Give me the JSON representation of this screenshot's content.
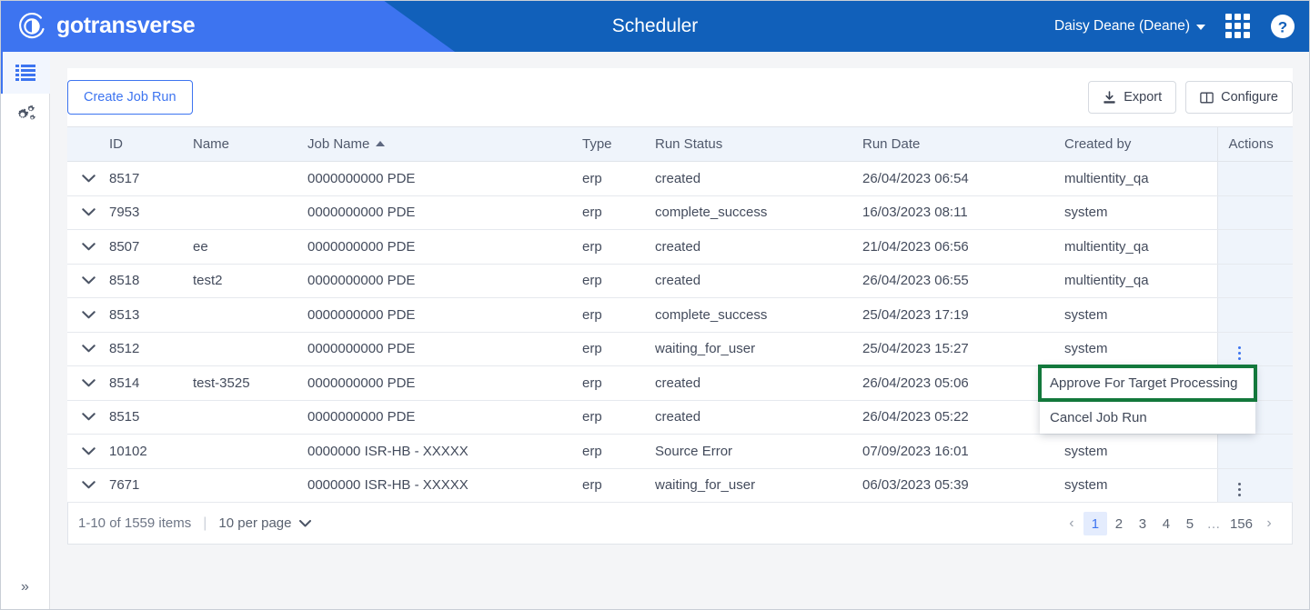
{
  "header": {
    "brand": "gotransverse",
    "brand_logo_icon": "gotransverse-circle-logo",
    "title": "Scheduler",
    "user": "Daisy Deane (Deane)",
    "apps_icon": "grid-apps-icon",
    "help_icon": "help-question-icon",
    "bg_color": "#1160ba",
    "wedge_color": "#3d74f0"
  },
  "sidebar": {
    "items": [
      {
        "icon": "list-lines-icon",
        "name": "sidebar-item-jobs",
        "active": true
      },
      {
        "icon": "gears-settings-icon",
        "name": "sidebar-item-settings",
        "active": false
      }
    ],
    "collapse_icon": "chevron-double-right-icon"
  },
  "toolbar": {
    "create_label": "Create Job Run",
    "export_label": "Export",
    "export_icon": "download-icon",
    "configure_label": "Configure",
    "configure_icon": "columns-layout-icon"
  },
  "table": {
    "columns": [
      {
        "key": "expand",
        "label": ""
      },
      {
        "key": "id",
        "label": "ID"
      },
      {
        "key": "name",
        "label": "Name"
      },
      {
        "key": "job_name",
        "label": "Job Name",
        "sorted": "asc"
      },
      {
        "key": "type",
        "label": "Type"
      },
      {
        "key": "run_status",
        "label": "Run Status"
      },
      {
        "key": "run_date",
        "label": "Run Date"
      },
      {
        "key": "created_by",
        "label": "Created by"
      },
      {
        "key": "actions",
        "label": "Actions"
      }
    ],
    "rows": [
      {
        "id": "8517",
        "name": "",
        "job_name": "0000000000 PDE",
        "type": "erp",
        "run_status": "created",
        "run_date": "26/04/2023 06:54",
        "created_by": "multientity_qa",
        "kebab": "none"
      },
      {
        "id": "7953",
        "name": "",
        "job_name": "0000000000 PDE",
        "type": "erp",
        "run_status": "complete_success",
        "run_date": "16/03/2023 08:11",
        "created_by": "system",
        "kebab": "none"
      },
      {
        "id": "8507",
        "name": "ee",
        "job_name": "0000000000 PDE",
        "type": "erp",
        "run_status": "created",
        "run_date": "21/04/2023 06:56",
        "created_by": "multientity_qa",
        "kebab": "none"
      },
      {
        "id": "8518",
        "name": "test2",
        "job_name": "0000000000 PDE",
        "type": "erp",
        "run_status": "created",
        "run_date": "26/04/2023 06:55",
        "created_by": "multientity_qa",
        "kebab": "none"
      },
      {
        "id": "8513",
        "name": "",
        "job_name": "0000000000 PDE",
        "type": "erp",
        "run_status": "complete_success",
        "run_date": "25/04/2023 17:19",
        "created_by": "system",
        "kebab": "none"
      },
      {
        "id": "8512",
        "name": "",
        "job_name": "0000000000 PDE",
        "type": "erp",
        "run_status": "waiting_for_user",
        "run_date": "25/04/2023 15:27",
        "created_by": "system",
        "kebab": "blue"
      },
      {
        "id": "8514",
        "name": "test-3525",
        "job_name": "0000000000 PDE",
        "type": "erp",
        "run_status": "created",
        "run_date": "26/04/2023 05:06",
        "created_by": "",
        "kebab": "none"
      },
      {
        "id": "8515",
        "name": "",
        "job_name": "0000000000 PDE",
        "type": "erp",
        "run_status": "created",
        "run_date": "26/04/2023 05:22",
        "created_by": "",
        "kebab": "none"
      },
      {
        "id": "10102",
        "name": "",
        "job_name": "0000000 ISR-HB - XXXXX",
        "type": "erp",
        "run_status": "Source Error",
        "run_date": "07/09/2023 16:01",
        "created_by": "system",
        "kebab": "none"
      },
      {
        "id": "7671",
        "name": "",
        "job_name": "0000000 ISR-HB - XXXXX",
        "type": "erp",
        "run_status": "waiting_for_user",
        "run_date": "06/03/2023 05:39",
        "created_by": "system",
        "kebab": "grey"
      }
    ]
  },
  "footer": {
    "count_text": "1-10 of 1559 items",
    "per_page": "10 per page",
    "per_page_icon": "chevron-down-icon",
    "prev_icon": "‹",
    "next_icon": "›",
    "pages": [
      "1",
      "2",
      "3",
      "4",
      "5",
      "…",
      "156"
    ],
    "current_page": "1"
  },
  "action_menu": {
    "items": [
      {
        "label": "Approve For Target Processing",
        "highlighted": true
      },
      {
        "label": "Cancel Job Run",
        "highlighted": false
      }
    ],
    "highlight_color": "#13783c"
  }
}
